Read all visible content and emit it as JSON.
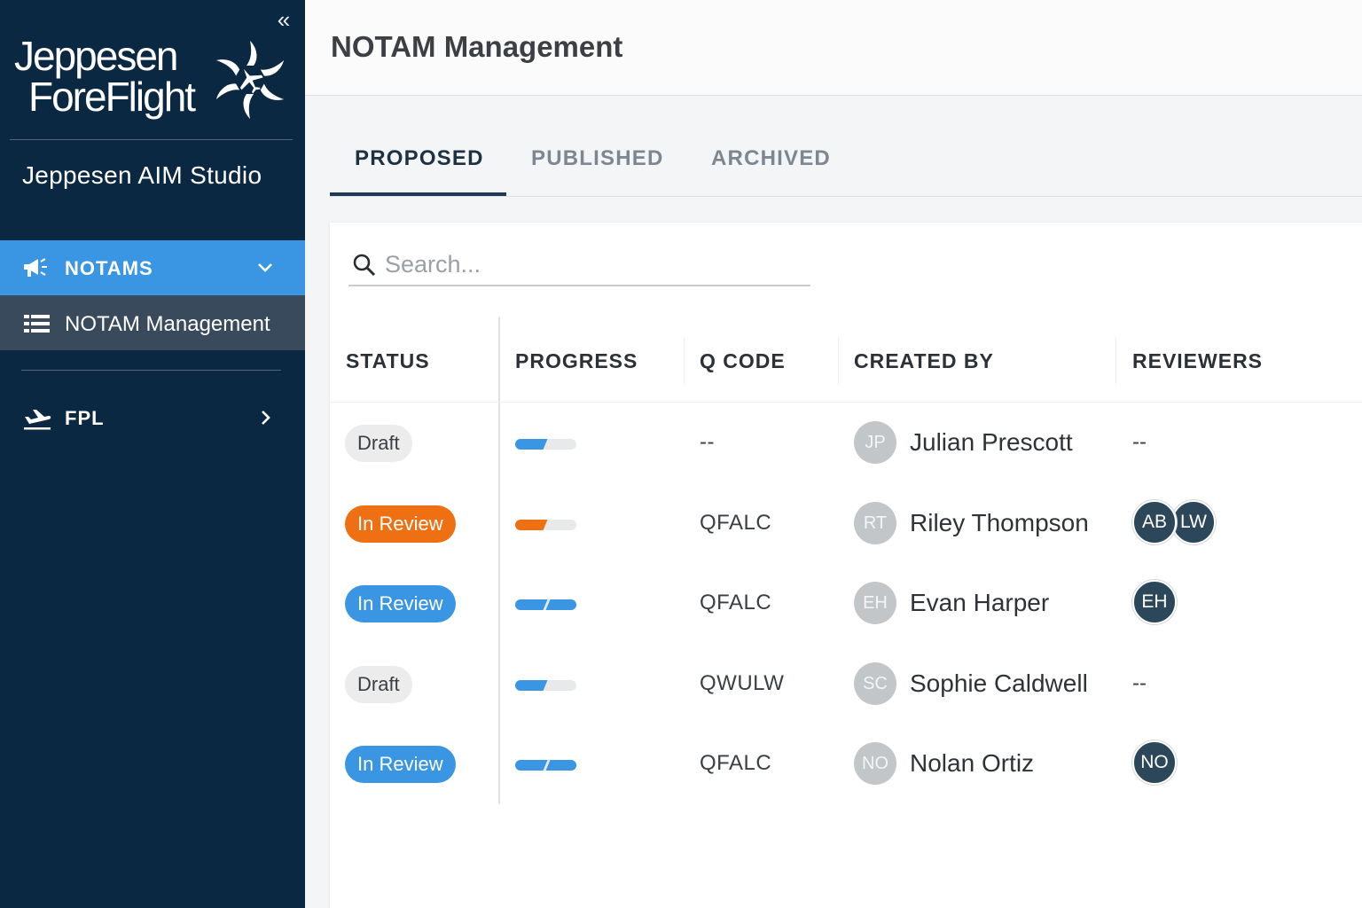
{
  "sidebar": {
    "collapse_icon": "double-chevron-left-icon",
    "logo": {
      "line1": "Jeppesen",
      "line2": "ForeFlight"
    },
    "app_title": "Jeppesen AIM Studio",
    "nav": {
      "notams": {
        "label": "NOTAMS",
        "icon": "megaphone-icon",
        "expanded": true
      },
      "notam_management": {
        "label": "NOTAM Management",
        "icon": "list-icon"
      },
      "fpl": {
        "label": "FPL",
        "icon": "plane-departure-icon",
        "expanded": false
      }
    }
  },
  "header": {
    "title": "NOTAM Management"
  },
  "tabs": [
    {
      "label": "PROPOSED",
      "active": true
    },
    {
      "label": "PUBLISHED",
      "active": false
    },
    {
      "label": "ARCHIVED",
      "active": false
    }
  ],
  "search": {
    "placeholder": "Search..."
  },
  "table": {
    "columns": [
      "STATUS",
      "PROGRESS",
      "Q CODE",
      "CREATED BY",
      "REVIEWERS"
    ],
    "rows": [
      {
        "status": "Draft",
        "status_style": "draft",
        "progress": 0.5,
        "progress_color": "#3a96e3",
        "qcode": "--",
        "creator_initials": "JP",
        "creator": "Julian Prescott",
        "reviewers": [],
        "reviewers_empty": "--"
      },
      {
        "status": "In Review",
        "status_style": "review-orange",
        "progress": 0.5,
        "progress_color": "#ee7012",
        "qcode": "QFALC",
        "creator_initials": "RT",
        "creator": "Riley Thompson",
        "reviewers": [
          "AB",
          "LW"
        ]
      },
      {
        "status": "In Review",
        "status_style": "review-blue",
        "progress": 1.0,
        "progress_color": "#3a96e3",
        "qcode": "QFALC",
        "creator_initials": "EH",
        "creator": "Evan Harper",
        "reviewers": [
          "EH"
        ]
      },
      {
        "status": "Draft",
        "status_style": "draft",
        "progress": 0.5,
        "progress_color": "#3a96e3",
        "qcode": "QWULW",
        "creator_initials": "SC",
        "creator": "Sophie Caldwell",
        "reviewers": [],
        "reviewers_empty": "--"
      },
      {
        "status": "In Review",
        "status_style": "review-blue",
        "progress": 1.0,
        "progress_color": "#3a96e3",
        "qcode": "QFALC",
        "creator_initials": "NO",
        "creator": "Nolan Ortiz",
        "reviewers": [
          "NO"
        ]
      }
    ]
  },
  "colors": {
    "sidebar_bg": "#0b2843",
    "accent_blue": "#3a96e3",
    "accent_orange": "#ee7012",
    "reviewer_avatar": "#2b4759",
    "creator_avatar": "#c3c6c9"
  }
}
